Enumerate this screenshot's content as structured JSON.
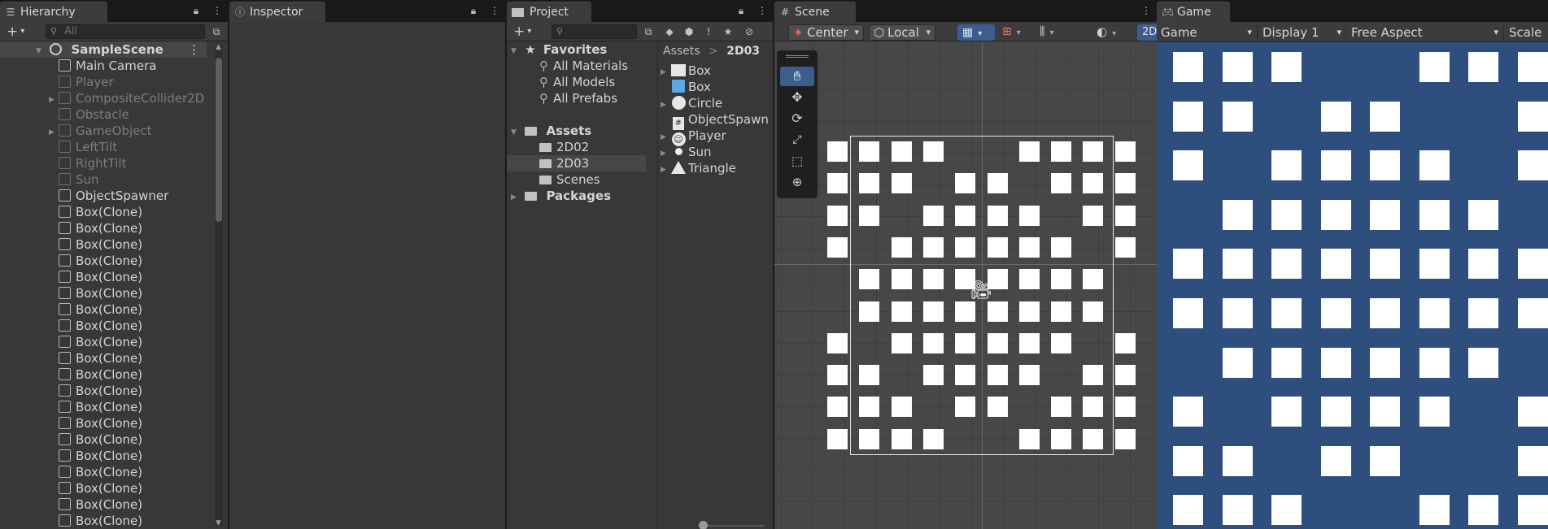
{
  "hierarchy": {
    "tab_label": "Hierarchy",
    "search_placeholder": "All",
    "scene_name": "SampleScene",
    "items": [
      {
        "label": "Main Camera",
        "dim": false,
        "foldable": false
      },
      {
        "label": "Player",
        "dim": true,
        "foldable": false
      },
      {
        "label": "CompositeCollider2D",
        "dim": true,
        "foldable": true
      },
      {
        "label": "Obstacle",
        "dim": true,
        "foldable": false
      },
      {
        "label": "GameObject",
        "dim": true,
        "foldable": true
      },
      {
        "label": "LeftTilt",
        "dim": true,
        "foldable": false
      },
      {
        "label": "RightTilt",
        "dim": true,
        "foldable": false
      },
      {
        "label": "Sun",
        "dim": true,
        "foldable": false
      },
      {
        "label": "ObjectSpawner",
        "dim": false,
        "foldable": false
      },
      {
        "label": "Box(Clone)",
        "dim": false,
        "foldable": false
      },
      {
        "label": "Box(Clone)",
        "dim": false,
        "foldable": false
      },
      {
        "label": "Box(Clone)",
        "dim": false,
        "foldable": false
      },
      {
        "label": "Box(Clone)",
        "dim": false,
        "foldable": false
      },
      {
        "label": "Box(Clone)",
        "dim": false,
        "foldable": false
      },
      {
        "label": "Box(Clone)",
        "dim": false,
        "foldable": false
      },
      {
        "label": "Box(Clone)",
        "dim": false,
        "foldable": false
      },
      {
        "label": "Box(Clone)",
        "dim": false,
        "foldable": false
      },
      {
        "label": "Box(Clone)",
        "dim": false,
        "foldable": false
      },
      {
        "label": "Box(Clone)",
        "dim": false,
        "foldable": false
      },
      {
        "label": "Box(Clone)",
        "dim": false,
        "foldable": false
      },
      {
        "label": "Box(Clone)",
        "dim": false,
        "foldable": false
      },
      {
        "label": "Box(Clone)",
        "dim": false,
        "foldable": false
      },
      {
        "label": "Box(Clone)",
        "dim": false,
        "foldable": false
      },
      {
        "label": "Box(Clone)",
        "dim": false,
        "foldable": false
      },
      {
        "label": "Box(Clone)",
        "dim": false,
        "foldable": false
      },
      {
        "label": "Box(Clone)",
        "dim": false,
        "foldable": false
      },
      {
        "label": "Box(Clone)",
        "dim": false,
        "foldable": false
      },
      {
        "label": "Box(Clone)",
        "dim": false,
        "foldable": false
      },
      {
        "label": "Box(Clone)",
        "dim": false,
        "foldable": false
      }
    ]
  },
  "inspector": {
    "tab_label": "Inspector"
  },
  "project": {
    "tab_label": "Project",
    "favorites": {
      "label": "Favorites",
      "items": [
        "All Materials",
        "All Models",
        "All Prefabs"
      ]
    },
    "assets": {
      "label": "Assets",
      "items": [
        "2D02",
        "2D03",
        "Scenes"
      ],
      "selected": "2D03"
    },
    "packages_label": "Packages",
    "breadcrumb": [
      "Assets",
      "2D03"
    ],
    "breadcrumb_sep": ">",
    "files": [
      {
        "label": "Box",
        "icon": "sprite-icon",
        "foldable": true
      },
      {
        "label": "Box",
        "icon": "prefab-icon",
        "foldable": false
      },
      {
        "label": "Circle",
        "icon": "circle-sprite-icon",
        "foldable": true
      },
      {
        "label": "ObjectSpawn",
        "icon": "script-icon",
        "foldable": false
      },
      {
        "label": "Player",
        "icon": "face-sprite-icon",
        "foldable": true
      },
      {
        "label": "Sun",
        "icon": "dot-sprite-icon",
        "foldable": true
      },
      {
        "label": "Triangle",
        "icon": "triangle-sprite-icon",
        "foldable": true
      }
    ]
  },
  "scene": {
    "tab_label": "Scene",
    "pivot_label": "Center",
    "space_label": "Local",
    "mode_2d_label": "2D",
    "grid": [
      "1111001111",
      "1110110111",
      "1101111011",
      "1011111101",
      "0111111110",
      "0111111110",
      "1011111101",
      "1101111011",
      "1110110111",
      "1111001111"
    ]
  },
  "game": {
    "tab_label": "Game",
    "view_label": "Game",
    "display_label": "Display 1",
    "aspect_label": "Free Aspect",
    "scale_label": "Scale",
    "bg_color": "#2e4f7e",
    "grid": [
      "11100111",
      "11011001",
      "10111101",
      "01111110",
      "11111111",
      "11111111",
      "01111110",
      "10111101",
      "11011001",
      "11100111"
    ]
  }
}
